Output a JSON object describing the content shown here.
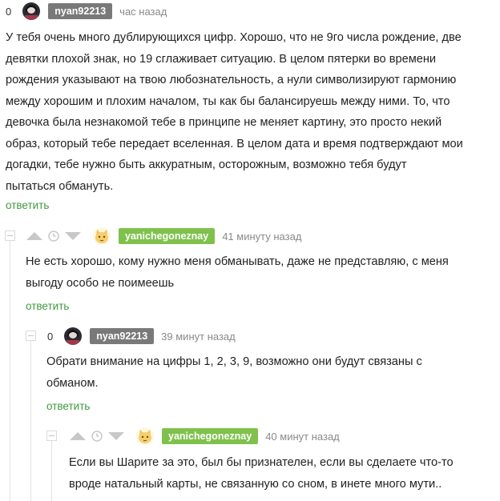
{
  "colors": {
    "nick_dark": "#797979",
    "nick_green": "#7fc14c",
    "reply_green": "#3f9a3f",
    "thread_line": "#e2e2e2",
    "vote_icon": "#c8c8c8"
  },
  "comments": [
    {
      "rating": "0",
      "author": "nyan92213",
      "time": "час назад",
      "avatar": "dark-avatar",
      "text_lines": [
        "У тебя очень много дублирующихся цифр. Хорошо, что не 9го числа рождение, две",
        "девятки плохой знак, но 19 сглаживает ситуацию. В целом пятерки во времени",
        "рождения указывают на твою любознательность, а нули символизируют гармонию",
        "между хорошим и плохим началом, ты как бы балансируешь между ними. То, что",
        "девочка была незнакомой тебе в принципе не меняет картину, это просто некий",
        "образ, который тебе передает вселенная. В целом дата и время подтверждают мои",
        "догадки, тебе нужно быть аккуратным, осторожным, возможно тебя будут",
        "пытаться обмануть."
      ],
      "reply": "ответить"
    },
    {
      "author": "yanichegoneznay",
      "time": "41 минуту назад",
      "avatar": "cat-avatar",
      "text_lines": [
        "Не есть хорошо, кому нужно меня обманывать, даже не представляю, с меня",
        "выгоду особо не поимеешь"
      ],
      "reply": "ответить"
    },
    {
      "rating": "0",
      "author": "nyan92213",
      "time": "39 минут назад",
      "avatar": "dark-avatar",
      "text_lines": [
        "Обрати внимание на цифры 1, 2, 3, 9, возможно они будут связаны с",
        "обманом."
      ],
      "reply": "ответить"
    },
    {
      "author": "yanichegoneznay",
      "time": "40 минут назад",
      "avatar": "cat-avatar",
      "text_lines": [
        "Если вы Шарите за это, был бы признателен, если вы сделаете что-то",
        "вроде натальный карты, не связанную со сном, в инете много мути.."
      ]
    }
  ]
}
